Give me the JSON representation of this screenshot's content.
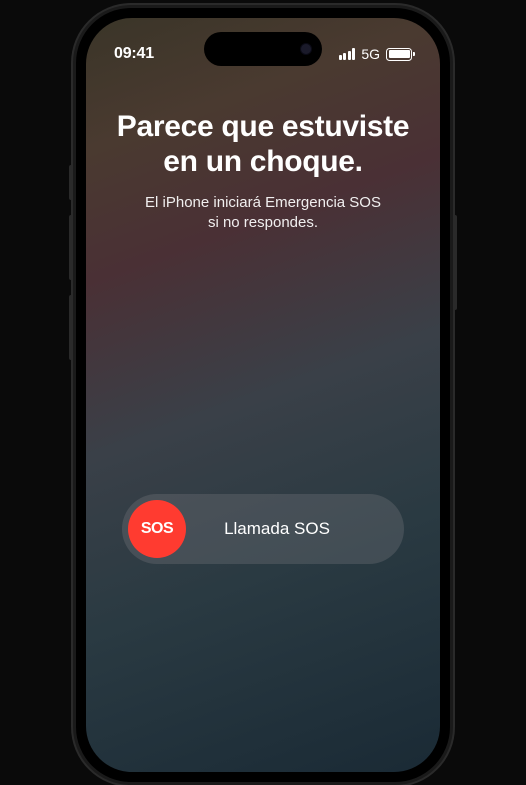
{
  "status_bar": {
    "time": "09:41",
    "network": "5G"
  },
  "alert": {
    "title_line1": "Parece que estuviste",
    "title_line2": "en un choque.",
    "subtitle_line1": "El iPhone iniciará Emergencia SOS",
    "subtitle_line2": "si no respondes."
  },
  "sos_slider": {
    "button_text": "SOS",
    "label": "Llamada SOS"
  },
  "colors": {
    "sos_red": "#ff3b30"
  }
}
